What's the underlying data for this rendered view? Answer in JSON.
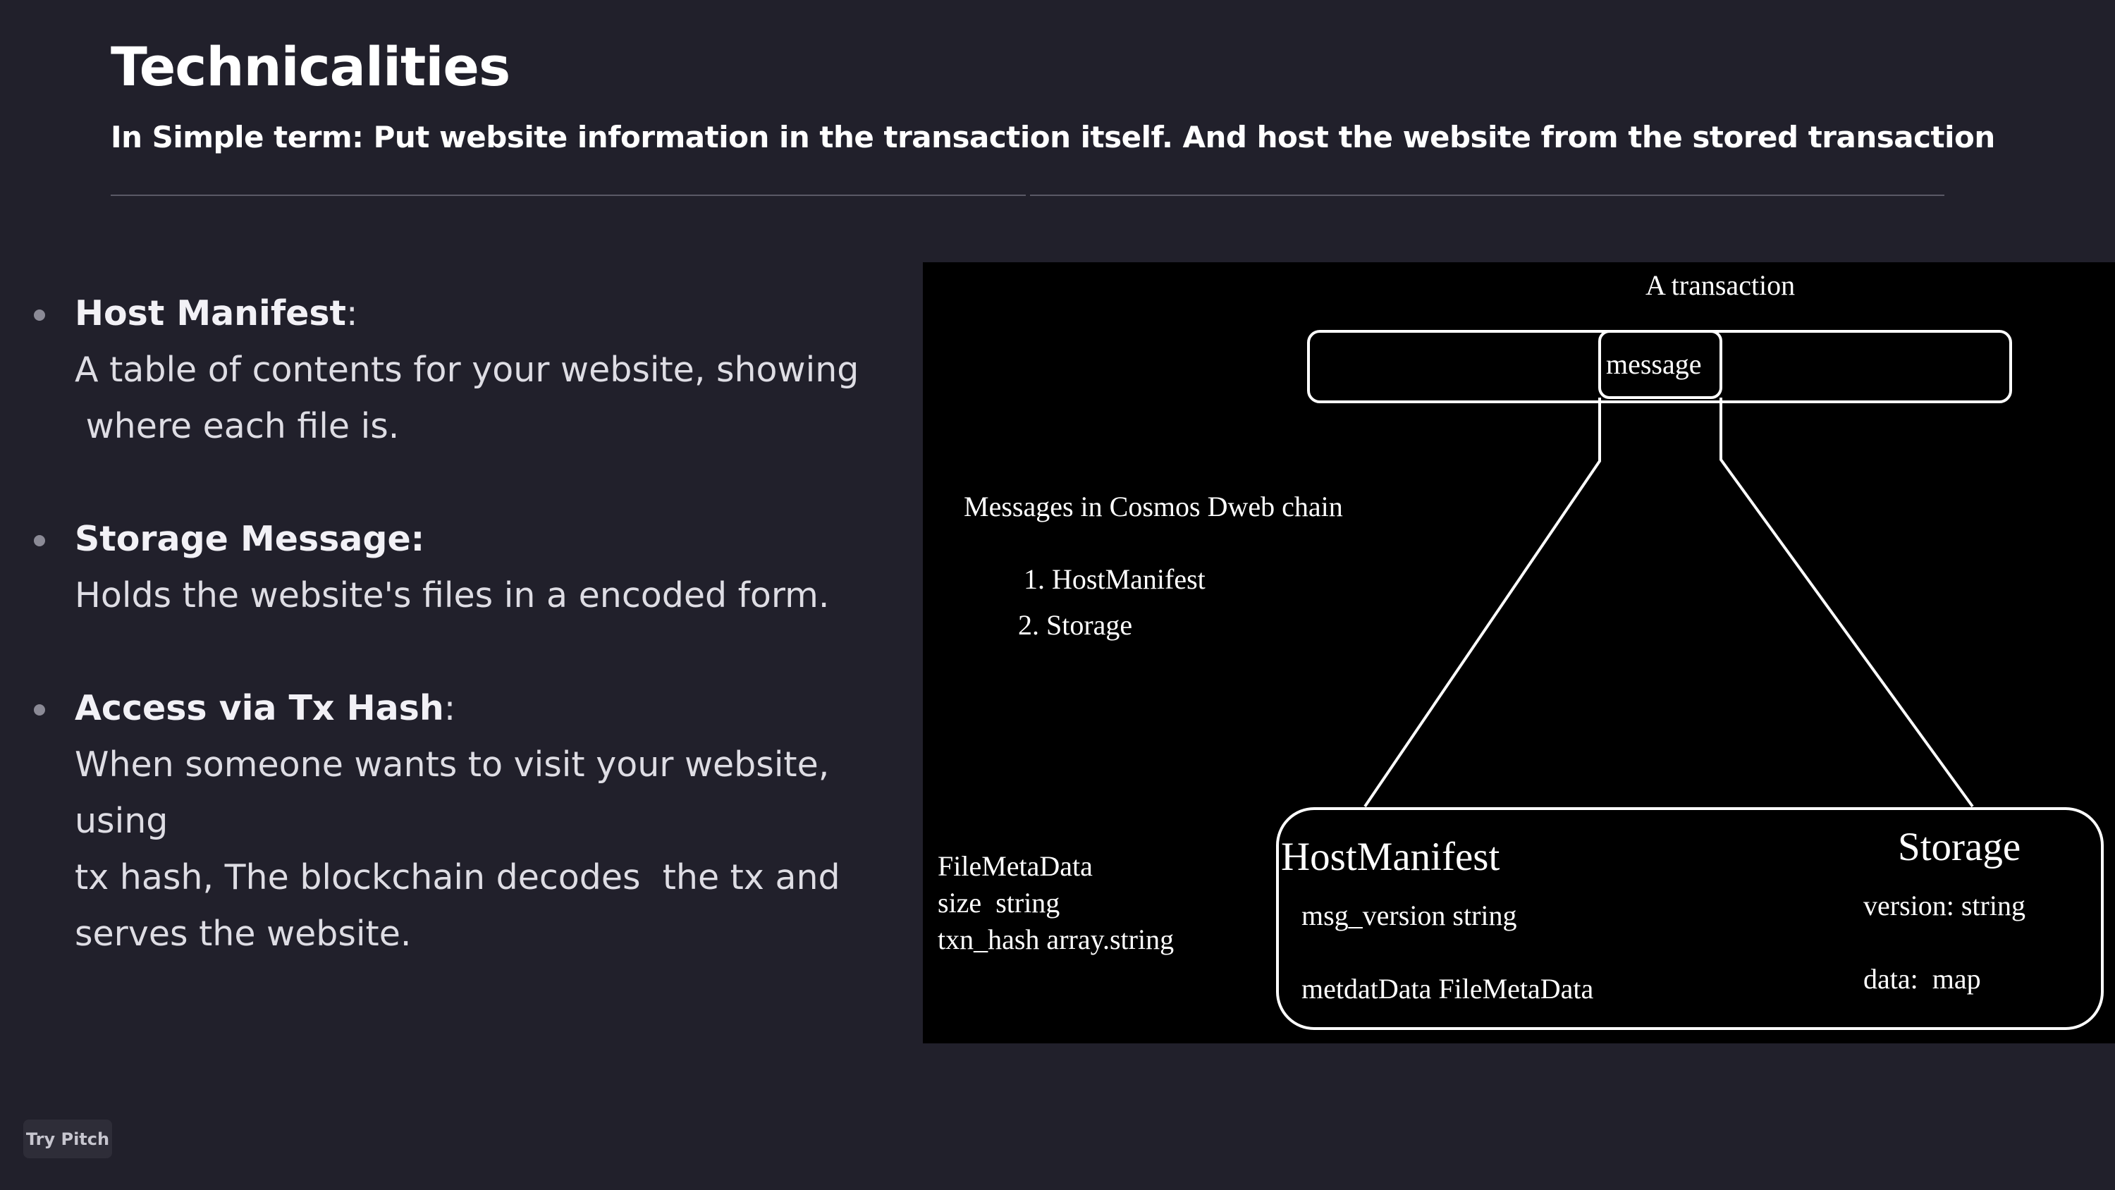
{
  "slide": {
    "title": "Technicalities",
    "subtitle_lead": "In Simple term: ",
    "subtitle_rest": "Put website information in the transaction itself. And host the website from the stored transaction"
  },
  "bullets": [
    {
      "head": "Host Manifest",
      "head_suffix": ":",
      "lines": [
        "A table of contents for your website, showing",
        " where each file is."
      ]
    },
    {
      "head": "Storage Message:",
      "head_suffix": "",
      "lines": [
        "Holds the website's files in a encoded form."
      ]
    },
    {
      "head": "Access via Tx Hash",
      "head_suffix": ":",
      "lines": [
        "When someone wants to visit your website, using",
        "tx hash, The blockchain decodes  the tx and",
        "serves the website."
      ]
    }
  ],
  "diagram": {
    "transaction_label": "A transaction",
    "message_label": "message",
    "messages_heading": "Messages in Cosmos Dweb chain",
    "message_types": [
      "1. HostManifest",
      "2. Storage"
    ],
    "filemetadata": [
      "FileMetaData",
      "size  string",
      "txn_hash array.string"
    ],
    "hostmanifest": {
      "title": "HostManifest",
      "fields": [
        "msg_version string",
        "metdatData FileMetaData"
      ]
    },
    "storage": {
      "title": "Storage",
      "fields": [
        "version: string",
        "data:  map"
      ]
    }
  },
  "footer": {
    "try_pitch": "Try Pitch"
  }
}
